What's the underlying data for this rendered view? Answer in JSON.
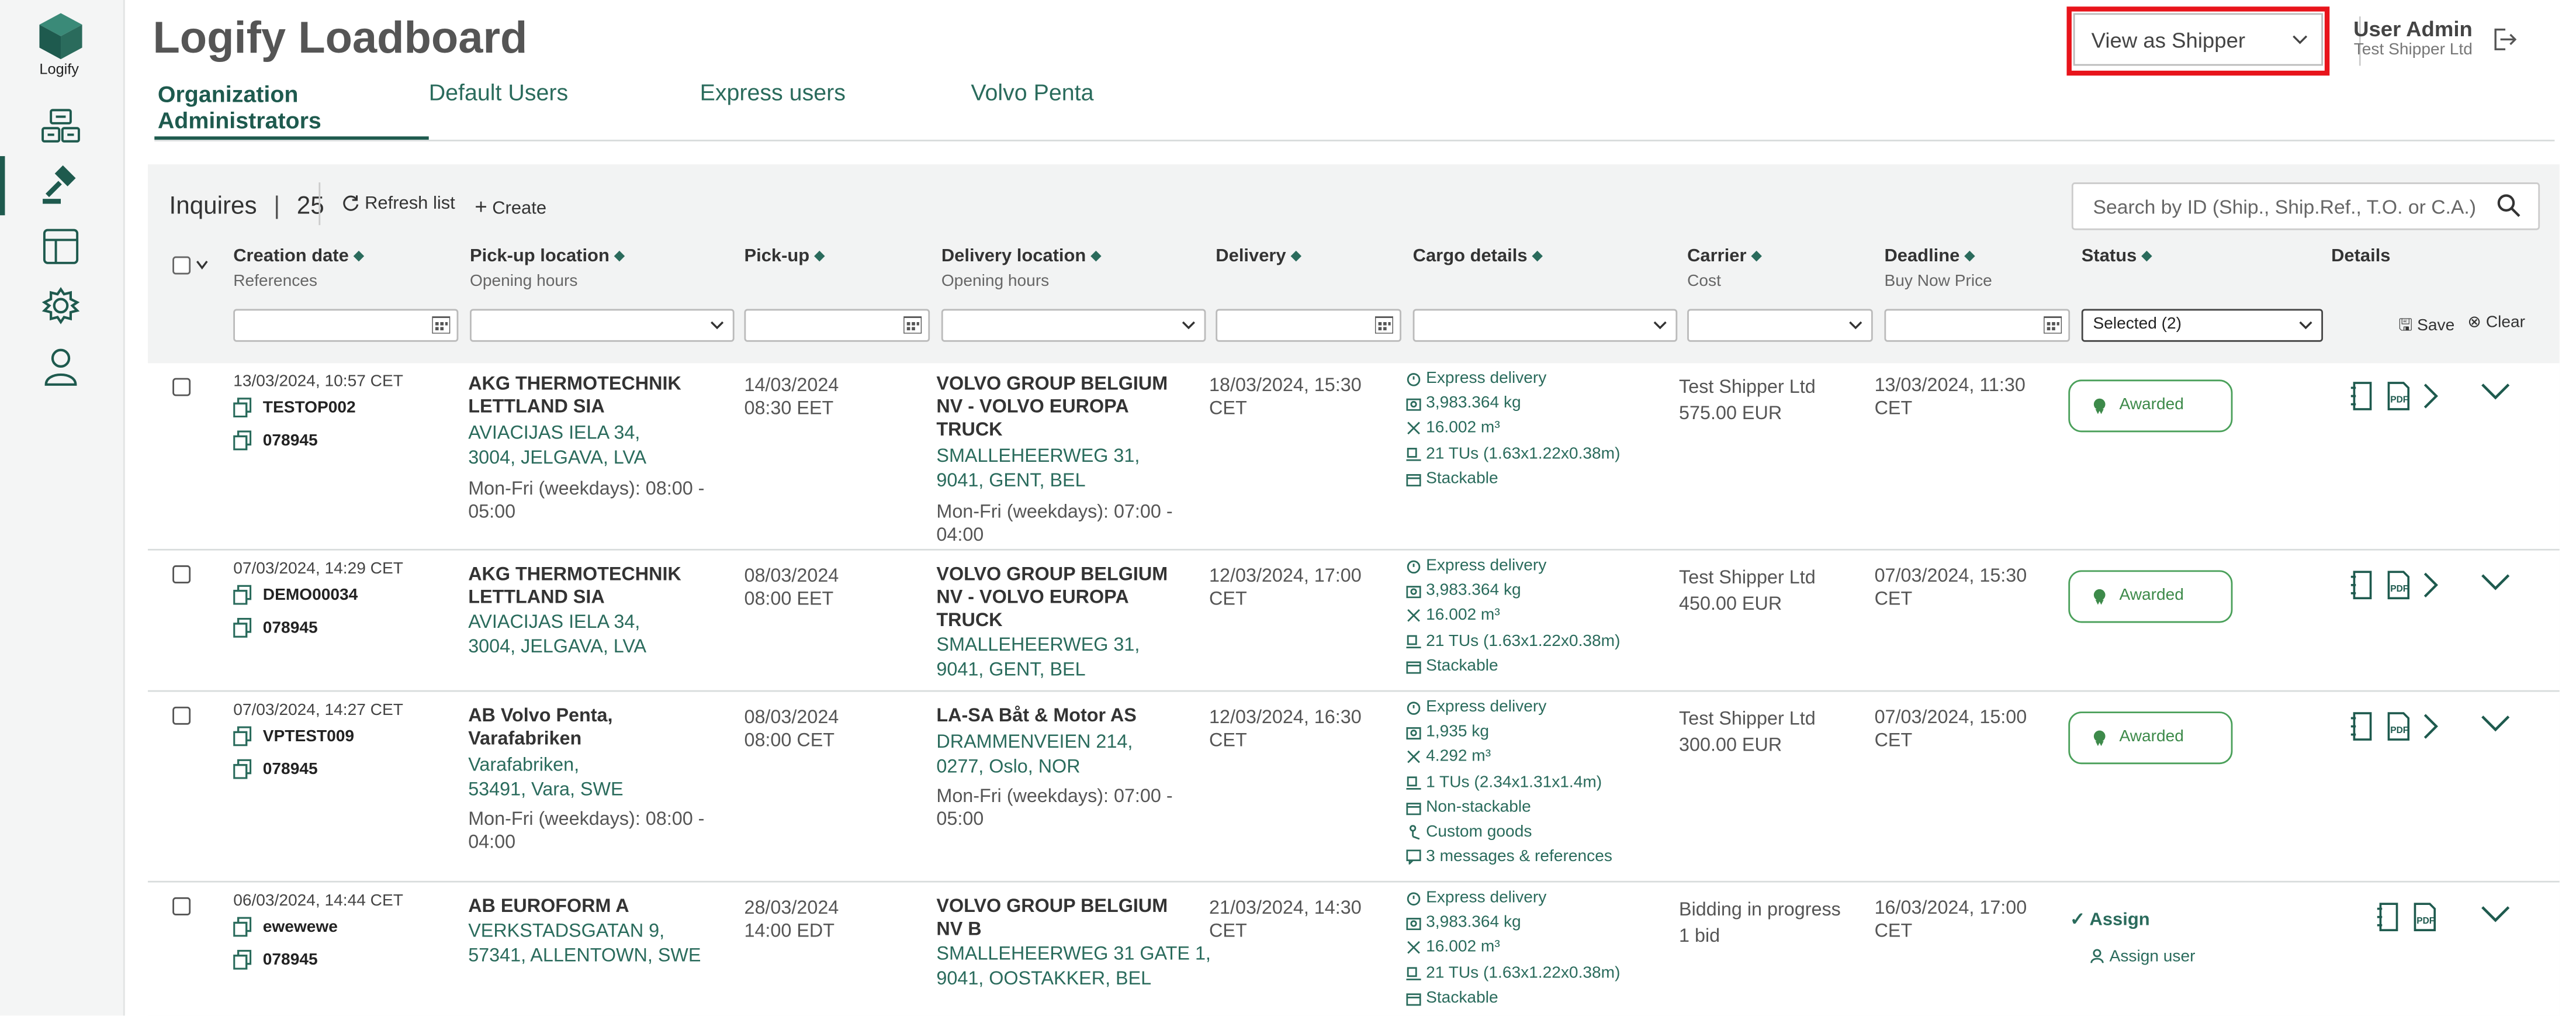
{
  "app": {
    "logo_text": "Logify",
    "title": "Logify Loadboard"
  },
  "tabs": [
    {
      "label": "Organization Administrators",
      "active": true
    },
    {
      "label": "Default Users"
    },
    {
      "label": "Express users"
    },
    {
      "label": "Volvo Penta"
    }
  ],
  "header": {
    "view_select": "View as Shipper",
    "user_name": "User Admin",
    "user_org": "Test Shipper Ltd"
  },
  "toolbar": {
    "title": "Inquires",
    "count": "25",
    "refresh": "Refresh list",
    "create": "Create",
    "search_placeholder": "Search by ID (Ship., Ship.Ref., T.O. or C.A.)"
  },
  "columns": {
    "creation": "Creation date",
    "creation_sub": "References",
    "pickup_loc": "Pick-up location",
    "pickup_loc_sub": "Opening hours",
    "pickup": "Pick-up",
    "delivery_loc": "Delivery location",
    "delivery_loc_sub": "Opening hours",
    "delivery": "Delivery",
    "cargo": "Cargo details",
    "carrier": "Carrier",
    "carrier_sub": "Cost",
    "deadline": "Deadline",
    "deadline_sub": "Buy Now Price",
    "status": "Status",
    "details": "Details"
  },
  "filters": {
    "status_value": "Selected (2)",
    "save": "Save",
    "clear": "Clear"
  },
  "rows": [
    {
      "created": "13/03/2024, 10:57 CET",
      "ref1": "TESTOP002",
      "ref2": "078945",
      "pickup_name_1": "AKG THERMOTECHNIK",
      "pickup_name_2": "LETTLAND SIA",
      "pickup_addr_1": "AVIACIJAS IELA 34,",
      "pickup_addr_2": "3004, JELGAVA, LVA",
      "pickup_hours_1": "Mon-Fri (weekdays): 08:00 -",
      "pickup_hours_2": "05:00",
      "pickup_date": "14/03/2024",
      "pickup_time": "08:30 EET",
      "del_name_1": "VOLVO GROUP BELGIUM",
      "del_name_2": "NV - VOLVO EUROPA",
      "del_name_3": "TRUCK",
      "del_addr_1": "SMALLEHEERWEG 31,",
      "del_addr_2": "9041, GENT, BEL",
      "del_hours_1": "Mon-Fri (weekdays): 07:00 -",
      "del_hours_2": "04:00",
      "delivery_1": "18/03/2024, 15:30",
      "delivery_2": "CET",
      "cargo": [
        "Express delivery",
        "3,983.364 kg",
        "16.002 m³",
        "21 TUs (1.63x1.22x0.38m)",
        "Stackable"
      ],
      "carrier": "Test Shipper Ltd",
      "cost": "575.00 EUR",
      "deadline_1": "13/03/2024, 11:30",
      "deadline_2": "CET",
      "status": "Awarded"
    },
    {
      "created": "07/03/2024, 14:29 CET",
      "ref1": "DEMO00034",
      "ref2": "078945",
      "pickup_name_1": "AKG THERMOTECHNIK",
      "pickup_name_2": "LETTLAND SIA",
      "pickup_addr_1": "AVIACIJAS IELA 34,",
      "pickup_addr_2": "3004, JELGAVA, LVA",
      "pickup_date": "08/03/2024",
      "pickup_time": "08:00 EET",
      "del_name_1": "VOLVO GROUP BELGIUM",
      "del_name_2": "NV - VOLVO EUROPA",
      "del_name_3": "TRUCK",
      "del_addr_1": "SMALLEHEERWEG 31,",
      "del_addr_2": "9041, GENT, BEL",
      "delivery_1": "12/03/2024, 17:00",
      "delivery_2": "CET",
      "cargo": [
        "Express delivery",
        "3,983.364 kg",
        "16.002 m³",
        "21 TUs (1.63x1.22x0.38m)",
        "Stackable"
      ],
      "carrier": "Test Shipper Ltd",
      "cost": "450.00 EUR",
      "deadline_1": "07/03/2024, 15:30",
      "deadline_2": "CET",
      "status": "Awarded"
    },
    {
      "created": "07/03/2024, 14:27 CET",
      "ref1": "VPTEST009",
      "ref2": "078945",
      "pickup_name_1": "AB Volvo Penta,",
      "pickup_name_2": "Varafabriken",
      "pickup_addr_1": "Varafabriken,",
      "pickup_addr_2": "53491, Vara, SWE",
      "pickup_hours_1": "Mon-Fri (weekdays): 08:00 -",
      "pickup_hours_2": "04:00",
      "pickup_date": "08/03/2024",
      "pickup_time": "08:00 CET",
      "del_name_1": "LA-SA Båt & Motor AS",
      "del_addr_1": "DRAMMENVEIEN 214,",
      "del_addr_2": "0277, Oslo, NOR",
      "del_hours_1": "Mon-Fri (weekdays): 07:00 -",
      "del_hours_2": "05:00",
      "delivery_1": "12/03/2024, 16:30",
      "delivery_2": "CET",
      "cargo": [
        "Express delivery",
        "1,935 kg",
        "4.292 m³",
        "1 TUs (2.34x1.31x1.4m)",
        "Non-stackable",
        "Custom goods",
        "3 messages & references"
      ],
      "carrier": "Test Shipper Ltd",
      "cost": "300.00 EUR",
      "deadline_1": "07/03/2024, 15:00",
      "deadline_2": "CET",
      "status": "Awarded"
    },
    {
      "created": "06/03/2024, 14:44 CET",
      "ref1": "ewewewe",
      "ref2": "078945",
      "pickup_name_1": "AB EUROFORM A",
      "pickup_addr_1": "VERKSTADSGATAN 9,",
      "pickup_addr_2": "57341, ALLENTOWN, SWE",
      "pickup_date": "28/03/2024",
      "pickup_time": "14:00 EDT",
      "del_name_1": "VOLVO GROUP BELGIUM",
      "del_name_2": "NV B",
      "del_addr_1": "SMALLEHEERWEG 31 GATE 1,",
      "del_addr_2": "9041, OOSTAKKER, BEL",
      "delivery_1": "21/03/2024, 14:30",
      "delivery_2": "CET",
      "cargo": [
        "Express delivery",
        "3,983.364 kg",
        "16.002 m³",
        "21 TUs (1.63x1.22x0.38m)",
        "Stackable"
      ],
      "carrier": "Bidding in progress",
      "cost": "1 bid",
      "deadline_1": "16/03/2024, 17:00",
      "deadline_2": "CET",
      "assign": "Assign",
      "assign_user": "Assign user"
    }
  ]
}
